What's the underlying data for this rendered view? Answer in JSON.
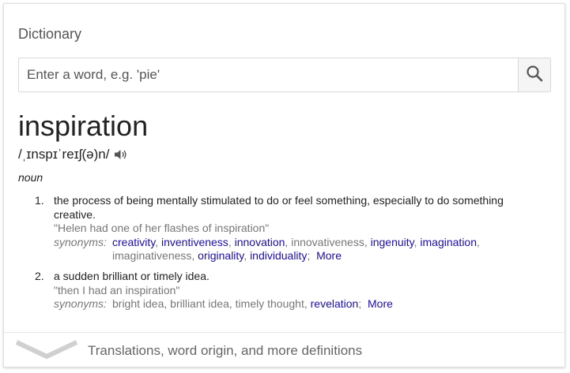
{
  "card": {
    "title": "Dictionary"
  },
  "search": {
    "placeholder": "Enter a word, e.g. 'pie'",
    "value": "",
    "button_icon": "magnifier-icon"
  },
  "entry": {
    "headword": "inspiration",
    "phonetic": "/ˌɪnspɪˈreɪʃ(ə)n/",
    "audio_icon": "speaker-icon",
    "part_of_speech": "noun",
    "senses": [
      {
        "number": "1.",
        "definition": "the process of being mentally stimulated to do or feel something, especially to do something creative.",
        "example": "\"Helen had one of her flashes of inspiration\"",
        "synonyms_label": "synonyms:",
        "synonyms": [
          {
            "text": "creativity",
            "link": true
          },
          {
            "text": "inventiveness",
            "link": true
          },
          {
            "text": "innovation",
            "link": true
          },
          {
            "text": "innovativeness",
            "link": false
          },
          {
            "text": "ingenuity",
            "link": true
          },
          {
            "text": "imagination",
            "link": true
          },
          {
            "text": "imaginativeness",
            "link": false
          },
          {
            "text": "originality",
            "link": true
          },
          {
            "text": "individuality",
            "link": true
          }
        ],
        "more": "More"
      },
      {
        "number": "2.",
        "definition": "a sudden brilliant or timely idea.",
        "example": "\"then I had an inspiration\"",
        "synonyms_label": "synonyms:",
        "synonyms": [
          {
            "text": "bright idea",
            "link": false
          },
          {
            "text": "brilliant idea",
            "link": false
          },
          {
            "text": "timely thought",
            "link": false
          },
          {
            "text": "revelation",
            "link": true
          }
        ],
        "more": "More"
      }
    ]
  },
  "footer": {
    "text": "Translations, word origin, and more definitions",
    "icon": "chevron-down-icon"
  },
  "colors": {
    "link": "#1a0dab",
    "muted": "#777777",
    "text": "#222222",
    "border": "#dfdfdf"
  }
}
